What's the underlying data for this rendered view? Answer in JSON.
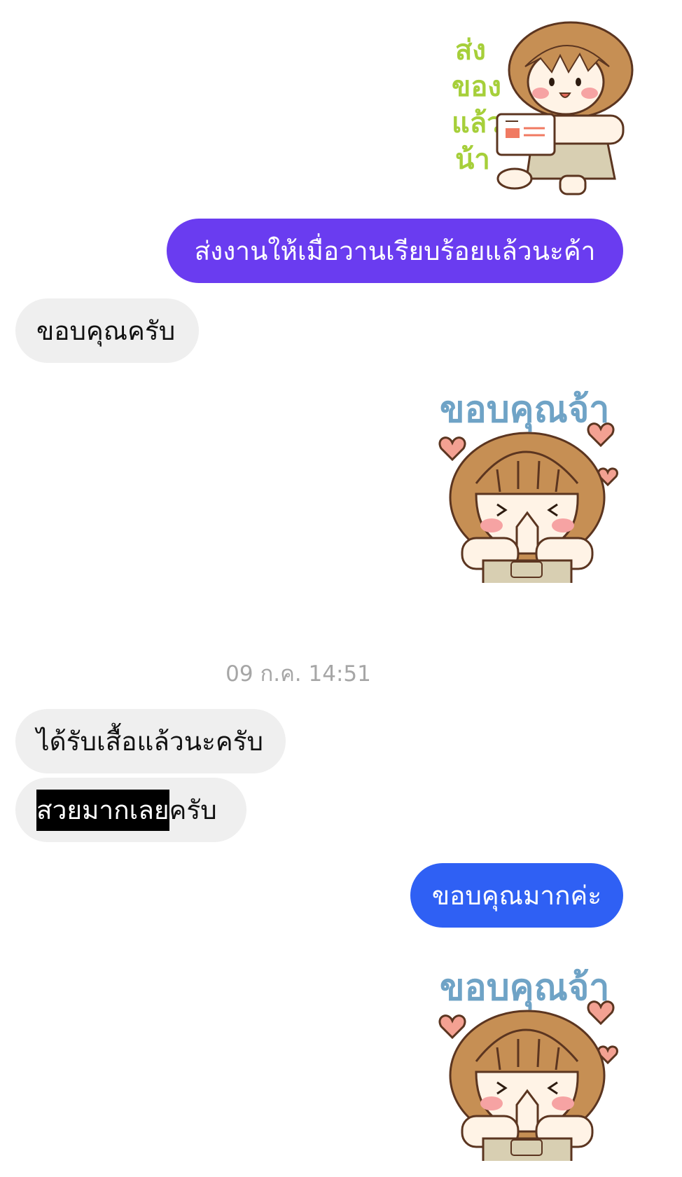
{
  "colors": {
    "outgoing_purple": "#6a3cf0",
    "outgoing_blue": "#2f60f4",
    "incoming_bg": "#efefef",
    "timestamp": "#a6a6a6"
  },
  "messages": {
    "sticker_1": {
      "text": "ส่งของแล้วน้า",
      "icon": "girl-holding-package-sticker"
    },
    "out_1": "ส่งงานให้เมื่อวานเรียบร้อยแล้วนะค้า",
    "in_1": "ขอบคุณครับ",
    "sticker_2": {
      "text": "ขอบคุณจ้า",
      "icon": "girl-thank-you-sticker"
    },
    "timestamp": "09 ก.ค. 14:51",
    "in_2": "ได้รับเสื้อแล้วนะครับ",
    "in_3_highlight": "สวยมากเลย",
    "in_3_rest": "ครับ",
    "out_2": "ขอบคุณมากค่ะ",
    "sticker_3": {
      "text": "ขอบคุณจ้า",
      "icon": "girl-thank-you-sticker"
    }
  }
}
